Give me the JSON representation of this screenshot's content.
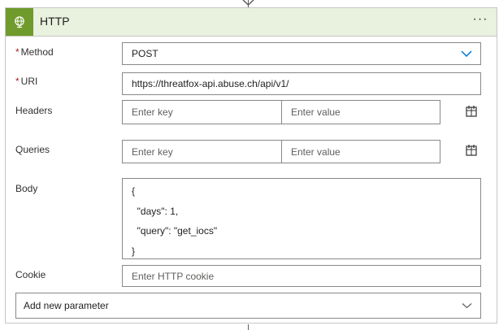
{
  "action": {
    "title": "HTTP",
    "icon": "globe-icon",
    "more_label": "···",
    "accent_color": "#6f9b2c"
  },
  "method": {
    "label": "Method",
    "required": true,
    "value": "POST"
  },
  "uri": {
    "label": "URI",
    "required": true,
    "value": "https://threatfox-api.abuse.ch/api/v1/"
  },
  "headers": {
    "label": "Headers",
    "key_placeholder": "Enter key",
    "value_placeholder": "Enter value"
  },
  "queries": {
    "label": "Queries",
    "key_placeholder": "Enter key",
    "value_placeholder": "Enter value"
  },
  "body": {
    "label": "Body",
    "lines": [
      "{",
      "  \"days\": 1,",
      "  \"query\": \"get_iocs\"",
      "}"
    ]
  },
  "cookie": {
    "label": "Cookie",
    "placeholder": "Enter HTTP cookie"
  },
  "add_parameter": {
    "label": "Add new parameter"
  }
}
